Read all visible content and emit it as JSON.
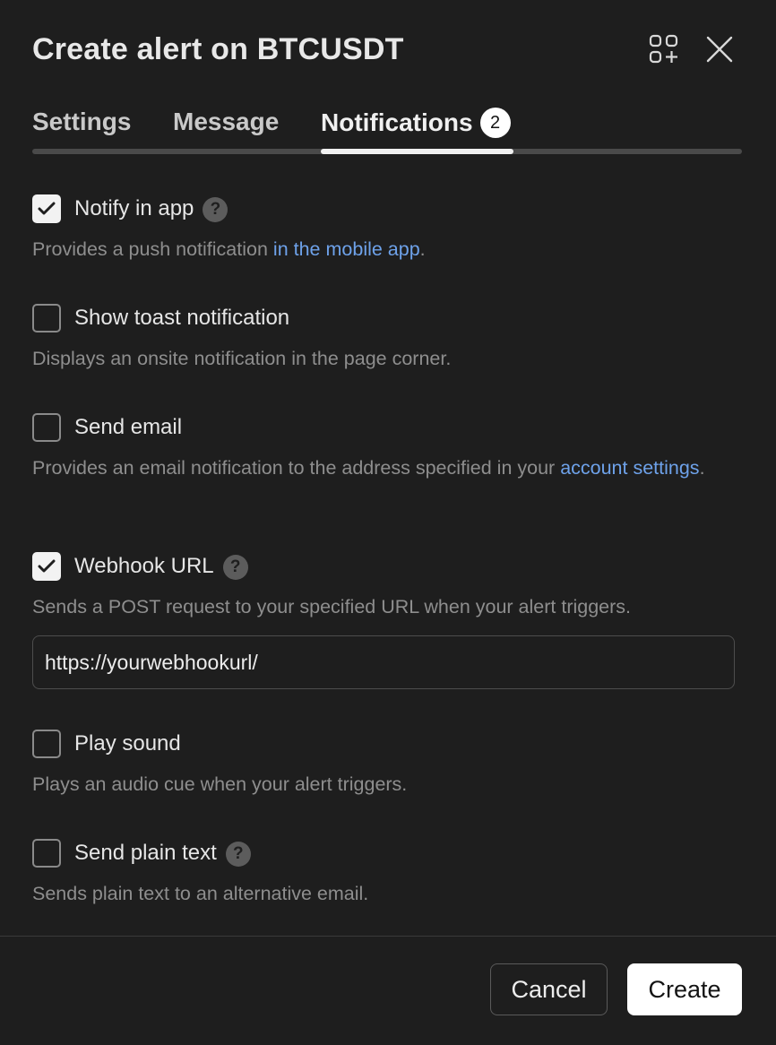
{
  "dialog": {
    "title": "Create alert on BTCUSDT",
    "icons": {
      "widget": "add-widget-icon",
      "close": "close-icon"
    }
  },
  "tabs": [
    {
      "label": "Settings",
      "active": false
    },
    {
      "label": "Message",
      "active": false
    },
    {
      "label": "Notifications",
      "active": true,
      "badge": "2"
    }
  ],
  "options": [
    {
      "label": "Notify in app",
      "checked": true,
      "help": true,
      "desc_pre": "Provides a push notification ",
      "desc_link": "in the mobile app",
      "desc_post": "."
    },
    {
      "label": "Show toast notification",
      "checked": false,
      "help": false,
      "desc": "Displays an onsite notification in the page corner."
    },
    {
      "label": "Send email",
      "checked": false,
      "help": false,
      "desc_pre": "Provides an email notification to the address specified in your ",
      "desc_link": "account settings",
      "desc_post": "."
    },
    {
      "label": "Webhook URL",
      "checked": true,
      "help": true,
      "desc": "Sends a POST request to your specified URL when your alert triggers."
    },
    {
      "label": "Play sound",
      "checked": false,
      "help": false,
      "desc": "Plays an audio cue when your alert triggers."
    },
    {
      "label": "Send plain text",
      "checked": false,
      "help": true,
      "desc": "Sends plain text to an alternative email."
    }
  ],
  "webhook": {
    "value": "https://yourwebhookurl/"
  },
  "footer": {
    "cancel_label": "Cancel",
    "create_label": "Create"
  },
  "help_glyph": "?",
  "colors": {
    "background": "#1e1e1e",
    "link": "#6ea2ea",
    "checkbox_checked": "#f2f2f2"
  }
}
